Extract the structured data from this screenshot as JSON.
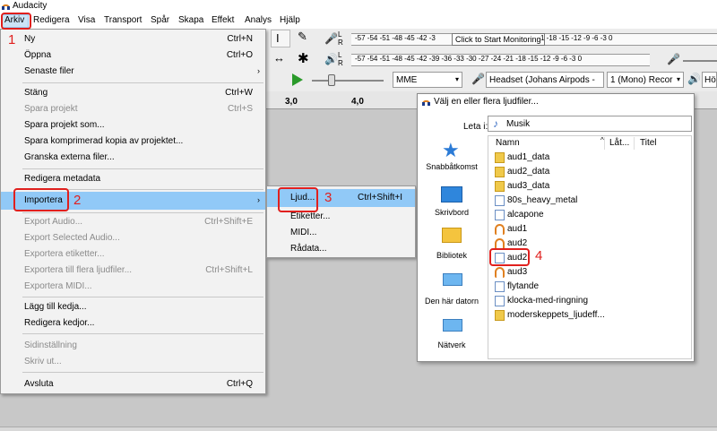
{
  "app": {
    "title": "Audacity"
  },
  "menubar": [
    "Arkiv",
    "Redigera",
    "Visa",
    "Transport",
    "Spår",
    "Skapa",
    "Effekt",
    "Analys",
    "Hjälp"
  ],
  "toolbar": {
    "meter_ticks_top": "-57 -54 -51 -48 -45 -42 -3",
    "monitor_tooltip": "Click to Start Monitoring",
    "meter_ticks_top_right": "1 -18 -15 -12 -9 -6 -3 0",
    "meter_ticks_bottom": "-57 -54 -51 -48 -45 -42 -39 -36 -33 -30 -27 -24 -21 -18 -15 -12 -9 -6 -3 0",
    "host": "MME",
    "input_device": "Headset (Johans Airpods -",
    "channels": "1 (Mono) Recor",
    "output_abbr": "Hö",
    "timeline_ticks": [
      "3,0",
      "4,0"
    ]
  },
  "arkiv_menu": [
    {
      "label": "Ny",
      "shortcut": "Ctrl+N",
      "disabled": false
    },
    {
      "label": "Öppna",
      "shortcut": "Ctrl+O",
      "disabled": false
    },
    {
      "label": "Senaste filer",
      "shortcut": "",
      "disabled": false,
      "submenu": true
    },
    {
      "label": "Stäng",
      "shortcut": "Ctrl+W",
      "disabled": false
    },
    {
      "label": "Spara projekt",
      "shortcut": "Ctrl+S",
      "disabled": true
    },
    {
      "label": "Spara projekt som...",
      "shortcut": "",
      "disabled": false
    },
    {
      "label": "Spara komprimerad kopia av projektet...",
      "shortcut": "",
      "disabled": false
    },
    {
      "label": "Granska externa filer...",
      "shortcut": "",
      "disabled": false
    },
    {
      "label": "Redigera metadata",
      "shortcut": "",
      "disabled": false
    },
    {
      "label": "Importera",
      "shortcut": "",
      "disabled": false,
      "submenu": true,
      "highlighted": true
    },
    {
      "label": "Export Audio...",
      "shortcut": "Ctrl+Shift+E",
      "disabled": true
    },
    {
      "label": "Export Selected Audio...",
      "shortcut": "",
      "disabled": true
    },
    {
      "label": "Exportera etiketter...",
      "shortcut": "",
      "disabled": true
    },
    {
      "label": "Exportera till flera ljudfiler...",
      "shortcut": "Ctrl+Shift+L",
      "disabled": true
    },
    {
      "label": "Exportera MIDI...",
      "shortcut": "",
      "disabled": true
    },
    {
      "label": "Lägg till kedja...",
      "shortcut": "",
      "disabled": false
    },
    {
      "label": "Redigera kedjor...",
      "shortcut": "",
      "disabled": false
    },
    {
      "label": "Sidinställning",
      "shortcut": "",
      "disabled": true
    },
    {
      "label": "Skriv ut...",
      "shortcut": "",
      "disabled": true
    },
    {
      "label": "Avsluta",
      "shortcut": "Ctrl+Q",
      "disabled": false
    }
  ],
  "import_menu": [
    {
      "label": "Ljud...",
      "shortcut": "Ctrl+Shift+I",
      "highlighted": true
    },
    {
      "label": "Etiketter...",
      "shortcut": ""
    },
    {
      "label": "MIDI...",
      "shortcut": ""
    },
    {
      "label": "Rådata...",
      "shortcut": ""
    }
  ],
  "dialog": {
    "title": "Välj en eller flera ljudfiler...",
    "look_in_label": "Leta i:",
    "look_in_value": "Musik",
    "places": [
      "Snabbåtkomst",
      "Skrivbord",
      "Bibliotek",
      "Den här datorn",
      "Nätverk"
    ],
    "columns": [
      "Namn",
      "Låt...",
      "Titel"
    ],
    "files": [
      {
        "name": "aud1_data",
        "type": "folder"
      },
      {
        "name": "aud2_data",
        "type": "folder"
      },
      {
        "name": "aud3_data",
        "type": "folder"
      },
      {
        "name": "80s_heavy_metal",
        "type": "note"
      },
      {
        "name": "alcapone",
        "type": "note"
      },
      {
        "name": "aud1",
        "type": "audacity"
      },
      {
        "name": "aud2",
        "type": "audacity"
      },
      {
        "name": "aud2",
        "type": "note"
      },
      {
        "name": "aud3",
        "type": "audacity"
      },
      {
        "name": "flytande",
        "type": "note"
      },
      {
        "name": "klocka-med-ringning",
        "type": "note"
      },
      {
        "name": "moderskeppets_ljudeff...",
        "type": "folder"
      }
    ]
  },
  "annotations": [
    "1",
    "2",
    "3",
    "4"
  ],
  "colors": {
    "highlight": "#91c9f7",
    "annotation": "#e0201e",
    "menubar_selected": "#cce4f7"
  }
}
